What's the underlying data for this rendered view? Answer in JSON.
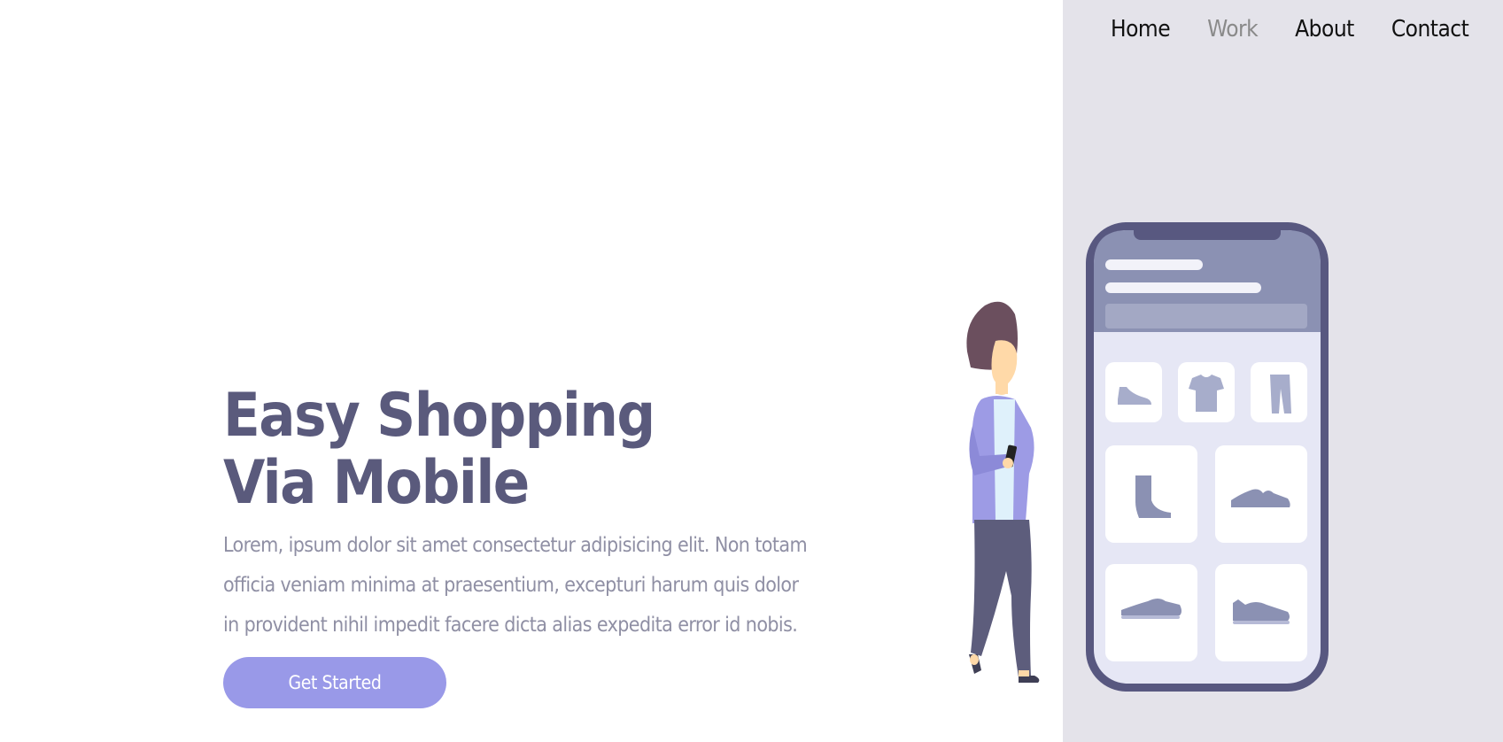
{
  "nav": {
    "items": [
      {
        "label": "Home",
        "active": false
      },
      {
        "label": "Work",
        "active": true
      },
      {
        "label": "About",
        "active": false
      },
      {
        "label": "Contact",
        "active": false
      }
    ]
  },
  "hero": {
    "title_line1": "Easy Shopping",
    "title_line2": "Via Mobile",
    "description": "Lorem, ipsum dolor sit amet consectetur adipisicing elit. Non totam officia veniam minima at praesentium, excepturi harum quis dolor in provident nihil impedit facere dicta alias expedita error id nobis.",
    "cta_label": "Get Started"
  },
  "colors": {
    "title": "#5a5a7c",
    "accent": "#9999e8",
    "panel": "#e4e3ea",
    "phone_frame": "#585880"
  },
  "illustration": {
    "person": "woman-holding-phone",
    "phone_icons": [
      "sneaker-icon",
      "tshirt-icon",
      "pants-icon",
      "boot-icon",
      "running-shoe-icon",
      "sneaker-icon",
      "sneaker-icon"
    ]
  }
}
